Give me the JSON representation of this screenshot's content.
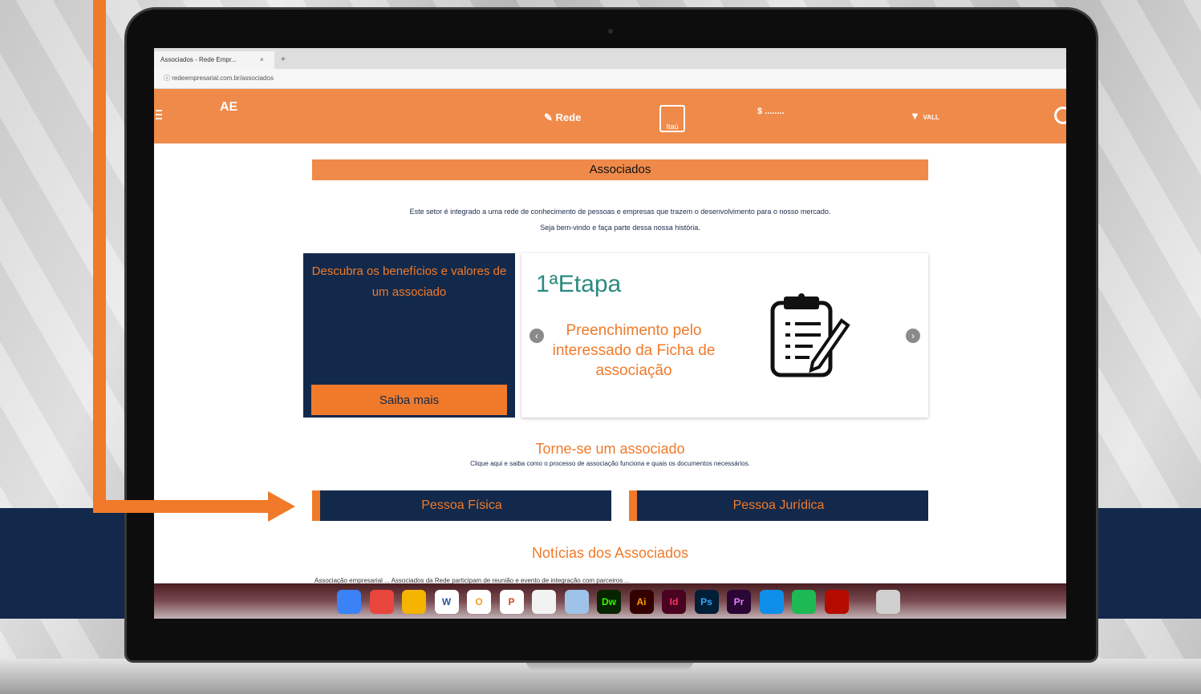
{
  "browser": {
    "tab_title": "Associados - Rede Empr...",
    "tab_close": "×",
    "new_tab": "+",
    "url": "ⓘ redeempresarial.com.br/associados"
  },
  "site_nav": {
    "logo": "AE",
    "partners": [
      {
        "label": "Rede",
        "icon": "rede-logo-icon"
      },
      {
        "label": "Itaú",
        "icon": "itau-logo-icon"
      },
      {
        "label": "$ ........",
        "icon": "santander-logo-icon"
      },
      {
        "label": "VALL",
        "icon": "vall-logo-icon"
      }
    ]
  },
  "section": {
    "title": "Associados",
    "intro_line1": "Este setor é integrado a uma rede de conhecimento de pessoas e empresas que trazem o desenvolvimento para o nosso mercado.",
    "intro_line2": "Seja bem-vindo e faça parte dessa nossa história."
  },
  "left_card": {
    "text": "Descubra os benefícios e valores de um associado",
    "button": "Saiba mais"
  },
  "carousel": {
    "prev": "‹",
    "next": "›",
    "title": "1ªEtapa",
    "text": "Preenchimento pelo interessado da Ficha de associação",
    "icon": "clipboard-icon"
  },
  "join": {
    "title": "Torne-se um associado",
    "subtitle": "Clique aqui e saiba como o processo de associação funciona e quais os documentos necessários.",
    "person_button": "Pessoa Física",
    "company_button": "Pessoa Jurídica"
  },
  "news": {
    "title": "Notícias dos Associados",
    "snippet": "Associação empresarial ...          Associados da Rede participam de reunião e evento de integração com parceiros ..."
  },
  "dock": {
    "items": [
      {
        "name": "finder-icon",
        "label": "",
        "bg": "#3b82f6",
        "fg": "#ffffff"
      },
      {
        "name": "chrome-icon",
        "label": "",
        "bg": "#e8453c",
        "fg": "#ffffff"
      },
      {
        "name": "cyberduck-icon",
        "label": "",
        "bg": "#f4b400",
        "fg": "#ffffff"
      },
      {
        "name": "word-icon",
        "label": "W",
        "bg": "#ffffff",
        "fg": "#2b579a"
      },
      {
        "name": "office-icon",
        "label": "O",
        "bg": "#ffffff",
        "fg": "#f0a020"
      },
      {
        "name": "powerpoint-icon",
        "label": "P",
        "bg": "#ffffff",
        "fg": "#d24726"
      },
      {
        "name": "calendar-icon",
        "label": "",
        "bg": "#f2f2f2",
        "fg": "#333333"
      },
      {
        "name": "preview-icon",
        "label": "",
        "bg": "#9fc3e8",
        "fg": "#333333"
      },
      {
        "name": "dreamweaver-icon",
        "label": "Dw",
        "bg": "#072401",
        "fg": "#35fa00"
      },
      {
        "name": "illustrator-icon",
        "label": "Ai",
        "bg": "#330000",
        "fg": "#ff9a00"
      },
      {
        "name": "indesign-icon",
        "label": "Id",
        "bg": "#49021f",
        "fg": "#ff3366"
      },
      {
        "name": "photoshop-icon",
        "label": "Ps",
        "bg": "#001e36",
        "fg": "#31a8ff"
      },
      {
        "name": "premiere-icon",
        "label": "Pr",
        "bg": "#2a0634",
        "fg": "#e77bff"
      },
      {
        "name": "teamviewer-icon",
        "label": "",
        "bg": "#0e8ee9",
        "fg": "#ffffff"
      },
      {
        "name": "spotify-icon",
        "label": "",
        "bg": "#1db954",
        "fg": "#000000"
      },
      {
        "name": "acrobat-icon",
        "label": "",
        "bg": "#b30b00",
        "fg": "#ffffff"
      },
      {
        "name": "trash-icon",
        "label": "",
        "bg": "#cfcfcf",
        "fg": "#555555"
      }
    ]
  },
  "colors": {
    "accent_orange": "#f07a2a",
    "navy": "#13294b",
    "teal": "#2a8a80"
  }
}
